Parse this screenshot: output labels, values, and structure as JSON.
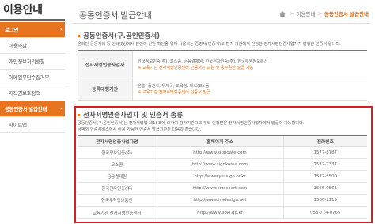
{
  "sidebar": {
    "title": "이용안내",
    "items": [
      {
        "label": "로그인",
        "active": true
      },
      {
        "label": "이용약관",
        "active": false
      },
      {
        "label": "개인정보처리방침",
        "active": false
      },
      {
        "label": "이메일무단수집거부",
        "active": false
      },
      {
        "label": "저작권보호정책",
        "active": false
      },
      {
        "label": "공동인증서 발급안내",
        "active": true
      },
      {
        "label": "사이트맵",
        "active": false
      }
    ],
    "arrow": "›"
  },
  "header": {
    "title": "공동인증서 발급안내",
    "breadcrumb": [
      "이용안내",
      "공동인증서 발급안내"
    ],
    "breadcrumb_sep": ">"
  },
  "section1": {
    "title": "공동인증서(구.공인인증서)",
    "description": "온라인 금융거래 등 인터넷상에서 본인의 신원 확인을 위해 사용되는 증명서(인증서)로 평가 기관에서 인정한 전자서명인증사업자가 발행한 인증서 입니다.",
    "rows": [
      {
        "head": "전자서명인증사업자",
        "lines": [
          "한국정보인증(주), 코스콤, 금융결제원, 한국전자인증(주), 한국무역정보통신",
          "※ 교육기관 전자서명인증센터 인증서는 교원 및 공무원만 발급 가능"
        ]
      },
      {
        "head": "등록대행기관",
        "lines": [
          "은행, 증권사, 우체국, 교육청, 대학(교) 등",
          "※ 교육기관 전자서명인증센터 인증서 발급"
        ]
      }
    ]
  },
  "section2": {
    "title": "전자서명인증사업자 및 인증서 종류",
    "description_lines": [
      "공동인증서(구.공인인증서)는 전자서명법 제18조에 의하여 평가기관으로 부터 인정받은 전자서명인증사업자에서 발급이 가능합니다.",
      "금액의 인증서비스에서 이용 가능한 인증서 발급기관은 다음과 같습니다."
    ],
    "columns": [
      "전자서명인증사업자명",
      "홈페이지 주소",
      "전화번호"
    ],
    "rows": [
      {
        "name": "한국정보인증(주)",
        "url": "http://www.signgate.com",
        "phone": "1577-8787"
      },
      {
        "name": "코스콤",
        "url": "http://www.signkorea.com",
        "phone": "1577-7337"
      },
      {
        "name": "금융결제원",
        "url": "http://www.yessign.or.kr",
        "phone": "1577-5500"
      },
      {
        "name": "한국전자인증(주)",
        "url": "http://www.crosscert.com",
        "phone": "1566-0566"
      },
      {
        "name": "한국무역정보통신",
        "url": "http://www.tradesign.net",
        "phone": "1566-2119"
      },
      {
        "name": "교육기관 전자서명인증센터",
        "url": "http://www.epki.go.kr",
        "phone": "053-714-0765"
      }
    ]
  },
  "colors": {
    "accent": "#e8731e",
    "highlight_border": "#d92020"
  },
  "icons": {
    "home": "home-icon"
  }
}
